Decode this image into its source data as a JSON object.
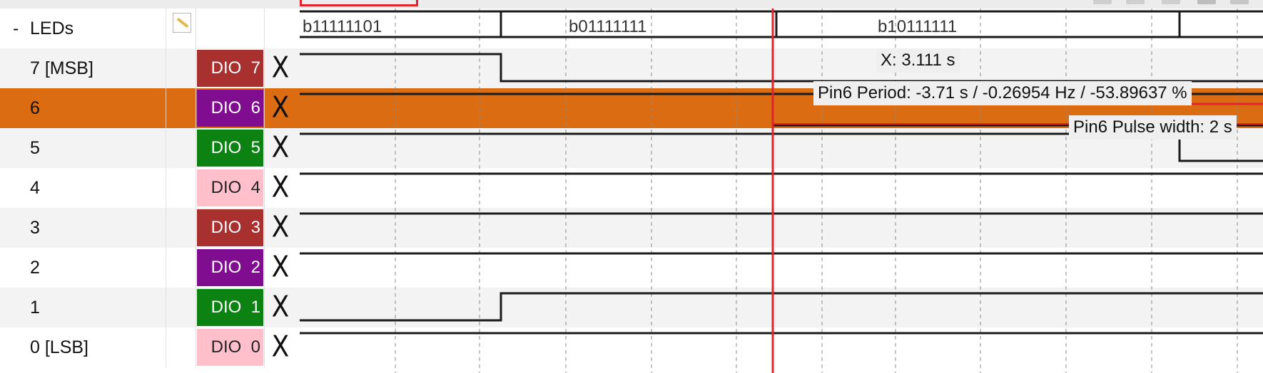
{
  "group": {
    "expander": "-",
    "name": "LEDs"
  },
  "channels": [
    {
      "name": "7 [MSB]",
      "pin_label": "DIO  7",
      "pin_color": "#a8302f",
      "remove": "X",
      "row_style": "alt"
    },
    {
      "name": "6",
      "pin_label": "DIO  6",
      "pin_color": "#800d8f",
      "remove": "X",
      "row_style": "selected"
    },
    {
      "name": "5",
      "pin_label": "DIO  5",
      "pin_color": "#0b8212",
      "remove": "X",
      "row_style": "alt"
    },
    {
      "name": "4",
      "pin_label": "DIO  4",
      "pin_color": "#ffc0cb",
      "remove": "X",
      "row_style": "white"
    },
    {
      "name": "3",
      "pin_label": "DIO  3",
      "pin_color": "#a8302f",
      "remove": "X",
      "row_style": "alt"
    },
    {
      "name": "2",
      "pin_label": "DIO  2",
      "pin_color": "#800d8f",
      "remove": "X",
      "row_style": "white"
    },
    {
      "name": "1",
      "pin_label": "DIO  1",
      "pin_color": "#0b8212",
      "remove": "X",
      "row_style": "alt"
    },
    {
      "name": "0 [LSB]",
      "pin_label": "DIO  0",
      "pin_color": "#ffc0cb",
      "remove": "X",
      "row_style": "white"
    }
  ],
  "bus_values": [
    "b11111101",
    "b01111111",
    "b10111111"
  ],
  "measurements": {
    "cursor_x": "X: 3.111 s",
    "period": "Pin6 Period: -3.71 s / -0.26954 Hz / -53.89637 %",
    "pulse_width": "Pin6 Pulse width: 2 s"
  },
  "colors": {
    "selected_row": "#db6c12",
    "cursor": "#e0242b",
    "trace": "#1a1a1a",
    "grid": "#8a8a8a"
  }
}
